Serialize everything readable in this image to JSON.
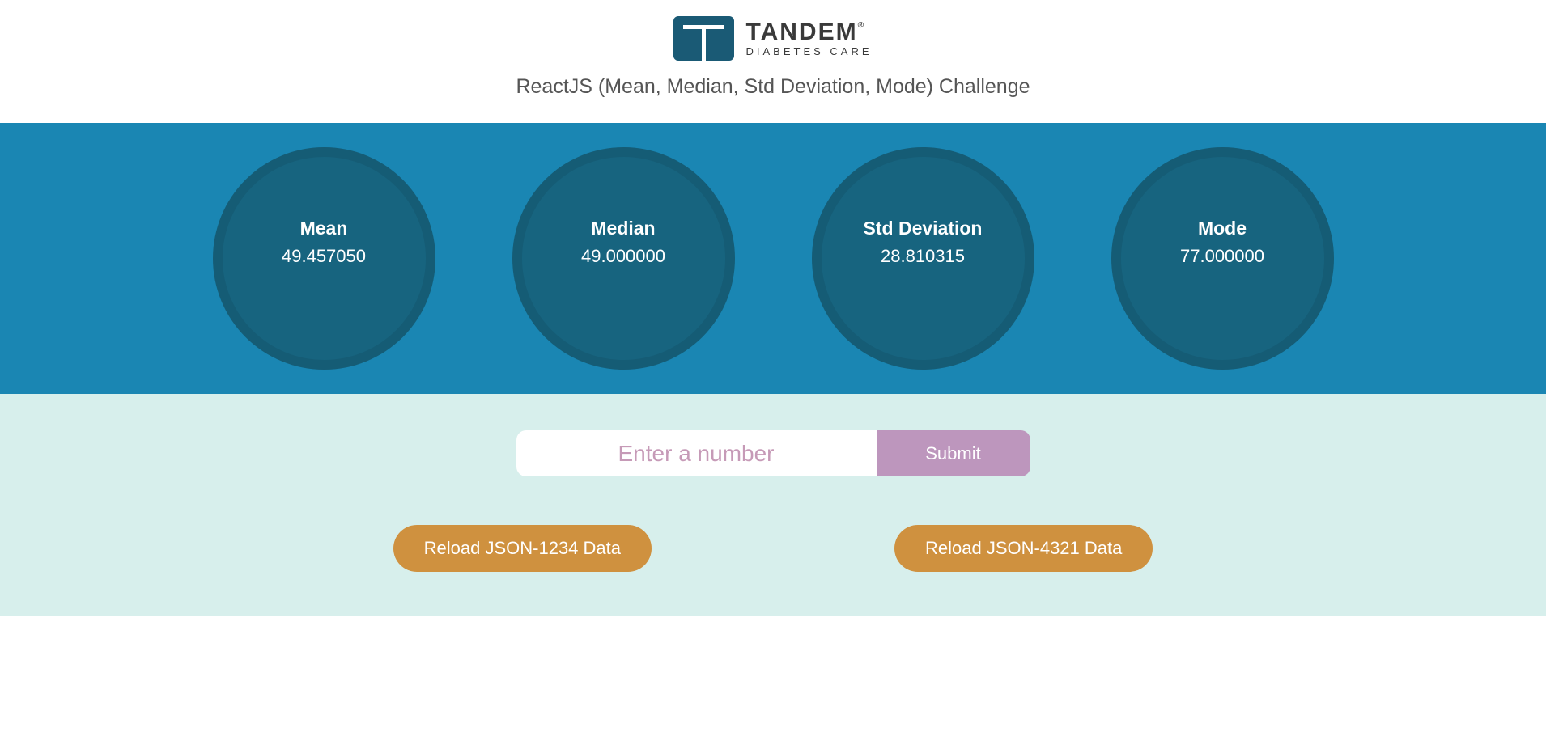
{
  "header": {
    "brand": "TANDEM",
    "brand_mark": "®",
    "tagline": "DIABETES CARE",
    "subtitle": "ReactJS (Mean, Median, Std Deviation, Mode) Challenge"
  },
  "stats": [
    {
      "label": "Mean",
      "value": "49.457050"
    },
    {
      "label": "Median",
      "value": "49.000000"
    },
    {
      "label": "Std Deviation",
      "value": "28.810315"
    },
    {
      "label": "Mode",
      "value": "77.000000"
    }
  ],
  "form": {
    "input_placeholder": "Enter a number",
    "input_value": "",
    "submit_label": "Submit"
  },
  "reload_buttons": [
    {
      "label": "Reload JSON-1234 Data"
    },
    {
      "label": "Reload JSON-4321 Data"
    }
  ]
}
